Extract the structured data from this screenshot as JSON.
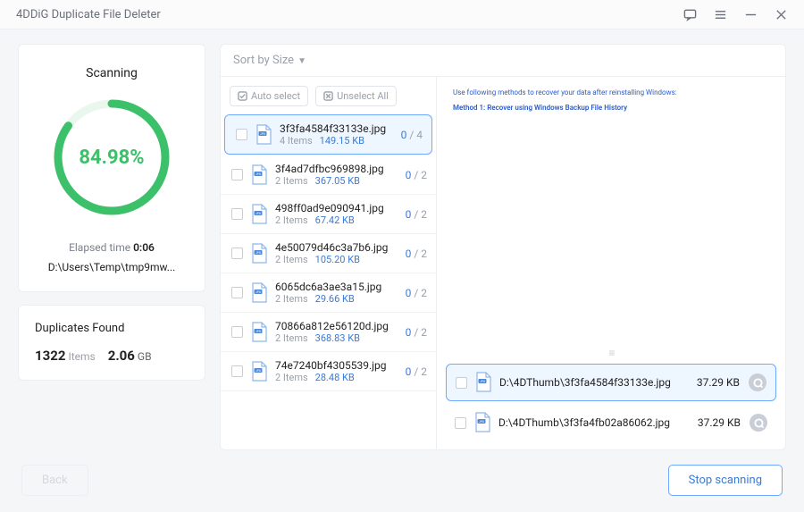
{
  "title": "4DDiG Duplicate File Deleter",
  "titlebar_icons": {
    "feedback": "feedback-icon",
    "menu": "menu-icon",
    "minimize": "minimize-icon",
    "close": "close-icon"
  },
  "scan": {
    "heading": "Scanning",
    "percent_label": "84.98%",
    "percent": 84.98,
    "elapsed_label": "Elapsed time ",
    "elapsed_value": "0:06",
    "path": "D:\\Users\\Temp\\tmp9mw..."
  },
  "dupes": {
    "heading": "Duplicates Found",
    "count": "1322",
    "count_label": "Items",
    "size": "2.06",
    "size_unit": "GB"
  },
  "sort": {
    "label": "Sort by Size",
    "chevron": "▼"
  },
  "toolbar": {
    "auto_select": "Auto select",
    "unselect_all": "Unselect All"
  },
  "groups": [
    {
      "name": "3f3fa4584f33133e.jpg",
      "items_label": "4 Items",
      "size": "149.15 KB",
      "sel": "0",
      "total": "4",
      "selected": true
    },
    {
      "name": "3f4ad7dfbc969898.jpg",
      "items_label": "2 Items",
      "size": "367.05 KB",
      "sel": "0",
      "total": "2",
      "selected": false
    },
    {
      "name": "498ff0ad9e090941.jpg",
      "items_label": "2 Items",
      "size": "67.42 KB",
      "sel": "0",
      "total": "2",
      "selected": false
    },
    {
      "name": "4e50079d46c3a7b6.jpg",
      "items_label": "2 Items",
      "size": "105.20 KB",
      "sel": "0",
      "total": "2",
      "selected": false
    },
    {
      "name": "6065dc6a3ae3a15.jpg",
      "items_label": "2 Items",
      "size": "29.66 KB",
      "sel": "0",
      "total": "2",
      "selected": false
    },
    {
      "name": "70866a812e56120d.jpg",
      "items_label": "2 Items",
      "size": "368.83 KB",
      "sel": "0",
      "total": "2",
      "selected": false
    },
    {
      "name": "74e7240bf4305539.jpg",
      "items_label": "2 Items",
      "size": "28.48 KB",
      "sel": "0",
      "total": "2",
      "selected": false
    }
  ],
  "preview": {
    "line1": "Use following methods to recover your data after reinstalling Windows:",
    "line2": "Method 1: Recover using Windows Backup File History"
  },
  "files": [
    {
      "path": "D:\\4DThumb\\3f3fa4584f33133e.jpg",
      "size": "37.29 KB",
      "active": true
    },
    {
      "path": "D:\\4DThumb\\3f3fa4fb02a86062.jpg",
      "size": "37.29 KB",
      "active": false
    }
  ],
  "footer": {
    "back": "Back",
    "stop": "Stop scanning"
  }
}
